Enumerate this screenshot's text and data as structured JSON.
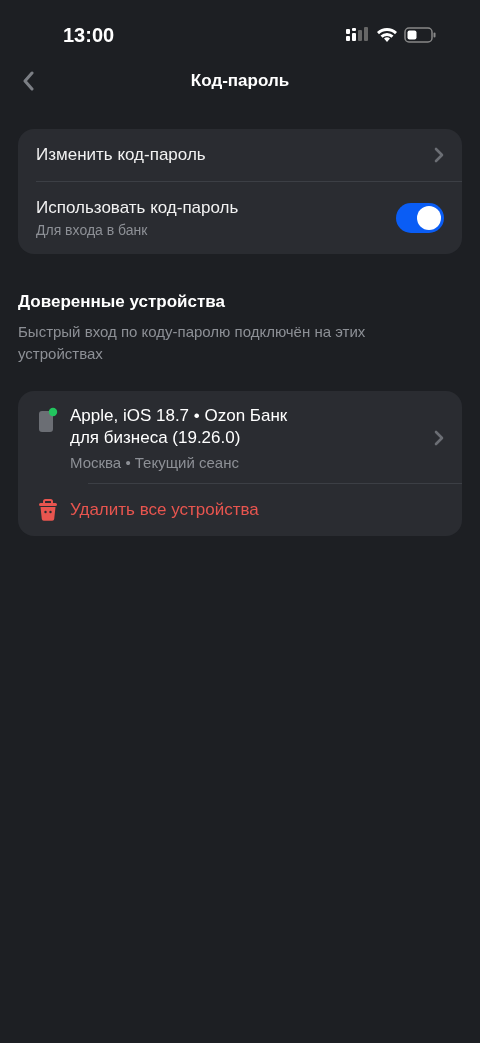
{
  "status_bar": {
    "time": "13:00"
  },
  "nav": {
    "title": "Код-пароль"
  },
  "settings": [
    {
      "kind": "link",
      "label": "Изменить код-пароль"
    },
    {
      "kind": "toggle",
      "label": "Использовать код-пароль",
      "subtitle": "Для входа в банк",
      "on": true
    }
  ],
  "trusted_devices": {
    "title": "Доверенные устройства",
    "description": "Быстрый вход по коду-паролю подключён на этих устройствах",
    "devices": [
      {
        "name": "Apple, iOS 18.7 • Ozon Банк для бизнеса (19.26.0)",
        "details": "Москва • Текущий сеанс",
        "online": true
      }
    ],
    "delete_all": "Удалить все устройства"
  }
}
